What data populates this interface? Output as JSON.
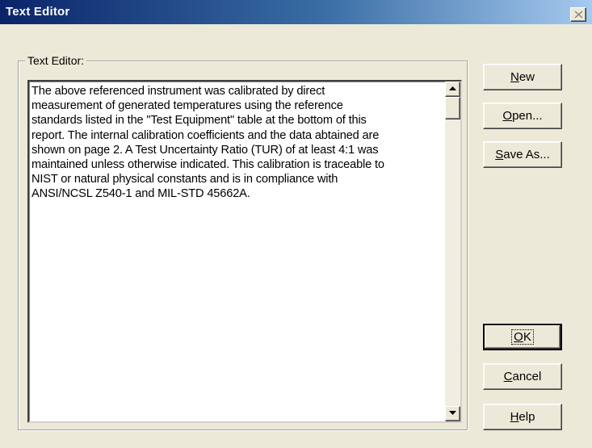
{
  "window": {
    "title": "Text Editor",
    "close_icon": "close-icon"
  },
  "group": {
    "label": "Text Editor:"
  },
  "editor": {
    "content": "The above referenced instrument was calibrated by direct\nmeasurement of generated temperatures using the reference\nstandards listed in the \"Test Equipment\" table at the bottom of this\nreport. The internal calibration coefficients and the data abtained are\nshown on page 2. A Test Uncertainty Ratio (TUR) of at least 4:1 was\nmaintained unless otherwise indicated. This calibration is traceable to\nNIST or natural physical constants and is in compliance with\nANSI/NCSL Z540-1 and MIL-STD 45662A."
  },
  "scrollbar": {
    "up_icon": "scroll-up-arrow-icon",
    "down_icon": "scroll-down-arrow-icon"
  },
  "buttons": {
    "new": {
      "accel": "N",
      "rest": "ew"
    },
    "open": {
      "accel": "O",
      "rest": "pen..."
    },
    "save_as": {
      "accel": "S",
      "rest": "ave As..."
    },
    "ok": {
      "accel": "O",
      "rest": "K"
    },
    "cancel": {
      "accel": "C",
      "rest": "ancel"
    },
    "help": {
      "accel": "H",
      "rest": "elp"
    }
  },
  "colors": {
    "title_start": "#0a246a",
    "title_end": "#a6caf0",
    "face": "#ece9d8"
  }
}
